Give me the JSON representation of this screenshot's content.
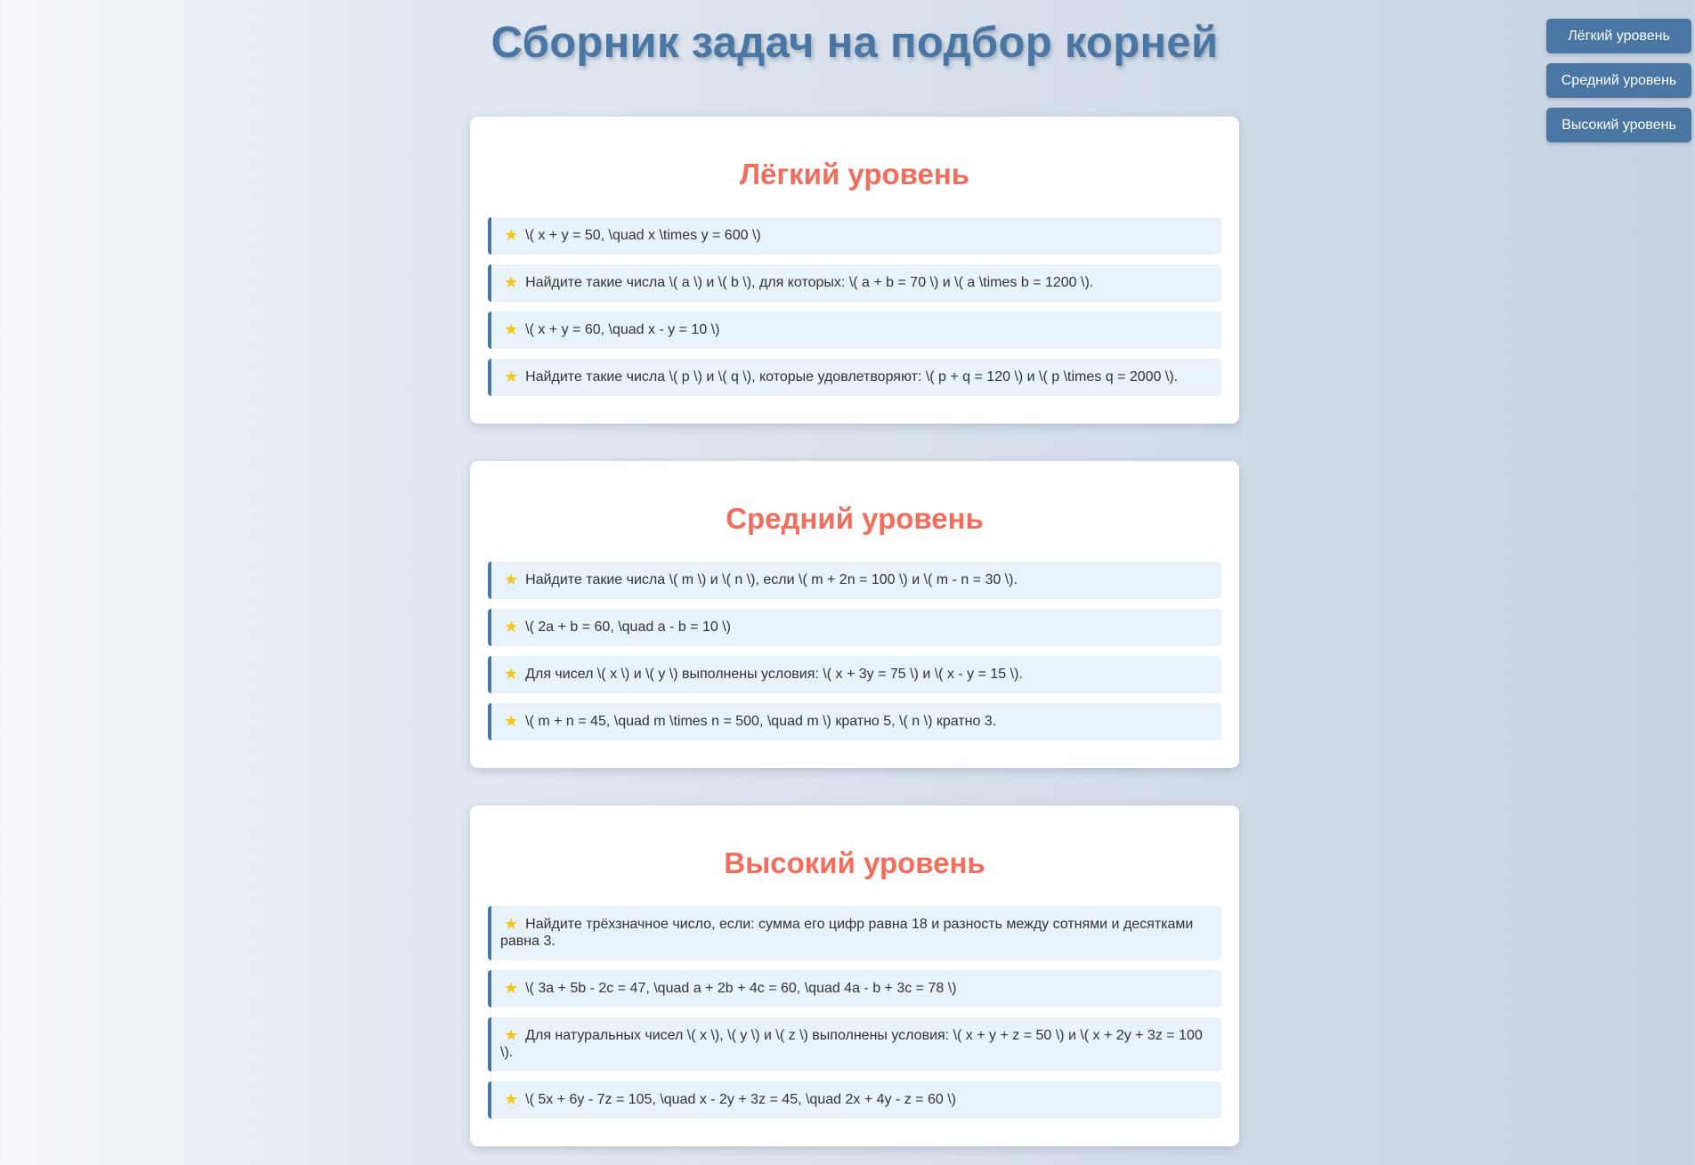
{
  "page": {
    "title": "Сборник задач на подбор корней"
  },
  "nav": {
    "buttons": [
      {
        "label": "Лёгкий уровень"
      },
      {
        "label": "Средний уровень"
      },
      {
        "label": "Высокий уровень"
      }
    ]
  },
  "icons": {
    "task_marker": "star-icon",
    "task_marker_color": "#f5c518"
  },
  "colors": {
    "title": "#4a76a3",
    "section_heading": "#f26d5b",
    "nav_button_bg": "#4a76a3",
    "task_bg": "#e8f2fa",
    "task_border": "#4a76a3"
  },
  "sections": [
    {
      "heading": "Лёгкий уровень",
      "tasks": [
        "\\( x + y = 50, \\quad x \\times y = 600 \\)",
        "Найдите такие числа \\( a \\) и \\( b \\), для которых: \\( a + b = 70 \\) и \\( a \\times b = 1200 \\).",
        "\\( x + y = 60, \\quad x - y = 10 \\)",
        "Найдите такие числа \\( p \\) и \\( q \\), которые удовлетворяют: \\( p + q = 120 \\) и \\( p \\times q = 2000 \\)."
      ]
    },
    {
      "heading": "Средний уровень",
      "tasks": [
        "Найдите такие числа \\( m \\) и \\( n \\), если \\( m + 2n = 100 \\) и \\( m - n = 30 \\).",
        "\\( 2a + b = 60, \\quad a - b = 10 \\)",
        "Для чисел \\( x \\) и \\( y \\) выполнены условия: \\( x + 3y = 75 \\) и \\( x - y = 15 \\).",
        "\\( m + n = 45, \\quad m \\times n = 500, \\quad m \\) кратно 5, \\( n \\) кратно 3."
      ]
    },
    {
      "heading": "Высокий уровень",
      "tasks": [
        "Найдите трёхзначное число, если: сумма его цифр равна 18 и разность между сотнями и десятками равна 3.",
        "\\( 3a + 5b - 2c = 47, \\quad a + 2b + 4c = 60, \\quad 4a - b + 3c = 78 \\)",
        "Для натуральных чисел \\( x \\), \\( y \\) и \\( z \\) выполнены условия: \\( x + y + z = 50 \\) и \\( x + 2y + 3z = 100 \\).",
        "\\( 5x + 6y - 7z = 105, \\quad x - 2y + 3z = 45, \\quad 2x + 4y - z = 60 \\)"
      ]
    }
  ]
}
